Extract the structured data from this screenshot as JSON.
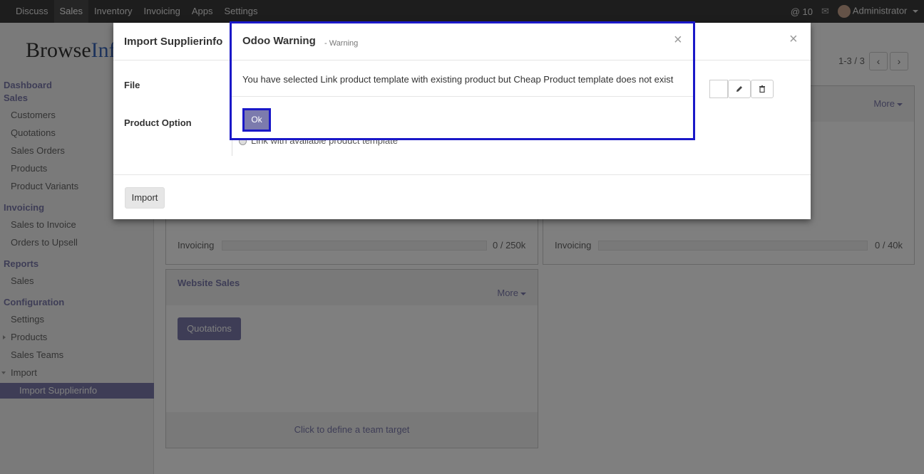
{
  "topbar": {
    "menu": [
      "Discuss",
      "Sales",
      "Inventory",
      "Invoicing",
      "Apps",
      "Settings"
    ],
    "active": "Sales",
    "mentions": "@ 10",
    "user": "Administrator"
  },
  "logo": {
    "part1": "Browse",
    "part2": "Inf"
  },
  "sidebar": {
    "dashboard": "Dashboard",
    "sales_header": "Sales",
    "customers": "Customers",
    "quotations": "Quotations",
    "sales_orders": "Sales Orders",
    "products": "Products",
    "product_variants": "Product Variants",
    "invoicing_header": "Invoicing",
    "sales_to_invoice": "Sales to Invoice",
    "orders_to_upsell": "Orders to Upsell",
    "reports_header": "Reports",
    "reports_sales": "Sales",
    "configuration_header": "Configuration",
    "settings": "Settings",
    "config_products": "Products",
    "sales_teams": "Sales Teams",
    "import": "Import",
    "import_supplierinfo": "Import Supplierinfo"
  },
  "pager": {
    "text": "1-3 / 3",
    "prev": "‹",
    "next": "›"
  },
  "cards": {
    "top_right_more": "More",
    "left_invoicing": "Invoicing",
    "left_invoicing_value": "0 / 250k",
    "left_invoicing_progress": 0,
    "right_invoicing": "Invoicing",
    "right_invoicing_value": "0 / 40k",
    "right_invoicing_progress": 0,
    "website_title": "Website Sales",
    "website_more": "More",
    "website_button": "Quotations",
    "website_footer": "Click to define a team target"
  },
  "import_dialog": {
    "title": "Import Supplierinfo",
    "close": "×",
    "file_label": "File",
    "product_option_label": "Product Option",
    "radio_text": "Link with available product template",
    "import_button": "Import"
  },
  "warning": {
    "title": "Odoo Warning",
    "subtitle": "- Warning",
    "close": "×",
    "message": "You have selected Link product template with existing product but Cheap Product template does not exist",
    "ok": "Ok"
  }
}
